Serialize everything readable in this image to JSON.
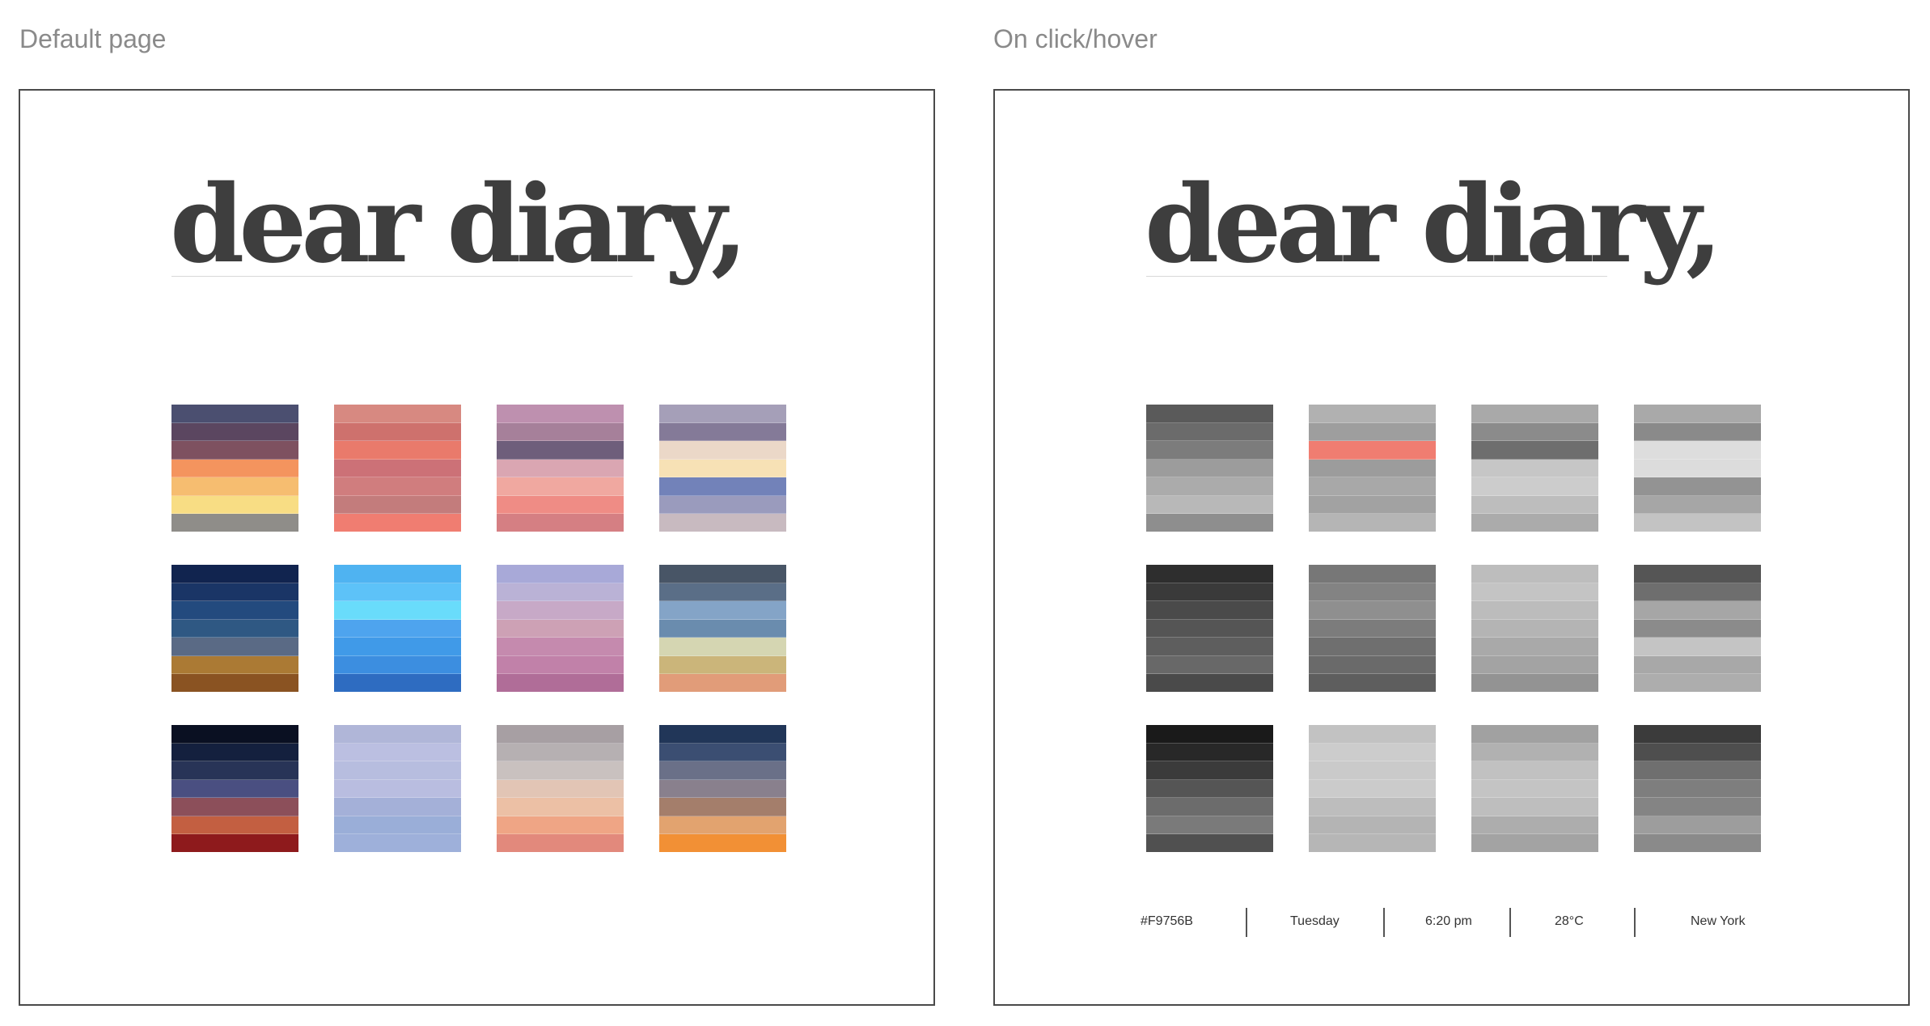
{
  "captions": {
    "left": "Default page",
    "right": "On click/hover"
  },
  "panels": {
    "left": {
      "title": "dear diary,"
    },
    "right": {
      "title": "dear diary,"
    }
  },
  "palettes_default": [
    [
      "#4B4F70",
      "#5B4660",
      "#7E5160",
      "#F4945E",
      "#F6BD70",
      "#F8DD84",
      "#8F8D89"
    ],
    [
      "#D78981",
      "#CE716D",
      "#E97A6B",
      "#CC7177",
      "#D07D7E",
      "#C37C7C",
      "#F07D71"
    ],
    [
      "#BE90AF",
      "#A6809A",
      "#6E5E7B",
      "#DAA6B2",
      "#F0A8A0",
      "#EF8C85",
      "#D57F83"
    ],
    [
      "#A59FB8",
      "#847A98",
      "#EBD8C8",
      "#F7E1B5",
      "#7282B9",
      "#9A9BBD",
      "#C8BAC0"
    ],
    [
      "#11244F",
      "#1A3566",
      "#234A7E",
      "#2F5883",
      "#5A6A85",
      "#AB7A34",
      "#8A5322"
    ],
    [
      "#4FB3F1",
      "#5DC2F8",
      "#69DCFB",
      "#4EA4EE",
      "#409AE8",
      "#3C8EE0",
      "#2E6CC1"
    ],
    [
      "#A8A9D8",
      "#BAB2D6",
      "#C7A9C7",
      "#CDA1B5",
      "#C58AAE",
      "#C181A9",
      "#B06D98"
    ],
    [
      "#485566",
      "#5A6E87",
      "#84A4C7",
      "#6A8CAE",
      "#D5D6B2",
      "#CBB57A",
      "#E19C79"
    ],
    [
      "#0A1022",
      "#14203E",
      "#283457",
      "#4A4F81",
      "#8C4F5A",
      "#C35F41",
      "#8E1A1C"
    ],
    [
      "#B0B6D8",
      "#BBBFE1",
      "#B7BDDF",
      "#B9BDE0",
      "#A4B0D8",
      "#9AAED8",
      "#9EB0DA"
    ],
    [
      "#A79FA3",
      "#B6B0B2",
      "#C9C1BF",
      "#E2C5B5",
      "#ECC0A5",
      "#EFA585",
      "#E2897C"
    ],
    [
      "#213658",
      "#3B4E72",
      "#6A7088",
      "#89808D",
      "#A47E6B",
      "#E2A36F",
      "#F29035"
    ]
  ],
  "palettes_hover": [
    [
      "#5A5A5A",
      "#6B6B6B",
      "#7C7C7C",
      "#9C9C9C",
      "#ABABAB",
      "#B8B8B8",
      "#8E8E8E"
    ],
    [
      "#B1B1B1",
      "#9E9E9E",
      "#F07D71",
      "#9C9C9C",
      "#A8A8A8",
      "#A2A2A2",
      "#B5B5B5"
    ],
    [
      "#A9A9A9",
      "#8B8B8B",
      "#6E6E6E",
      "#C6C6C6",
      "#CCCCCC",
      "#BDBDBD",
      "#ABABAB"
    ],
    [
      "#A9A9A9",
      "#8A8A8A",
      "#DDDDDD",
      "#DCDCDC",
      "#939393",
      "#A6A6A6",
      "#C3C3C3"
    ],
    [
      "#2E2E2E",
      "#3A3A3A",
      "#4A4A4A",
      "#555555",
      "#5E5E5E",
      "#686868",
      "#4A4A4A"
    ],
    [
      "#777777",
      "#838383",
      "#8F8F8F",
      "#7C7C7C",
      "#6F6F6F",
      "#6A6A6A",
      "#5E5E5E"
    ],
    [
      "#BDBDBD",
      "#C4C4C4",
      "#BCBCBC",
      "#B4B4B4",
      "#A9A9A9",
      "#A3A3A3",
      "#939393"
    ],
    [
      "#555555",
      "#6E6E6E",
      "#A6A6A6",
      "#8B8B8B",
      "#C4C4C4",
      "#A8A8A8",
      "#ADADAD"
    ],
    [
      "#1A1A1A",
      "#282828",
      "#3B3B3B",
      "#555555",
      "#6C6C6C",
      "#7A7A7A",
      "#505050"
    ],
    [
      "#C2C2C2",
      "#CCCCCC",
      "#CACACA",
      "#CBCBCB",
      "#BDBDBD",
      "#B4B4B4",
      "#B6B6B6"
    ],
    [
      "#A1A1A1",
      "#B1B1B1",
      "#C1C1C1",
      "#C4C4C4",
      "#BEBEBE",
      "#ADADAD",
      "#A3A3A3"
    ],
    [
      "#3B3B3B",
      "#4E4E4E",
      "#6F6F6F",
      "#7E7E7E",
      "#848484",
      "#9D9D9D",
      "#8A8A8A"
    ]
  ],
  "info_bar": {
    "hex": "#F9756B",
    "day": "Tuesday",
    "time": "6:20 pm",
    "temperature": "28°C",
    "city": "New York"
  }
}
